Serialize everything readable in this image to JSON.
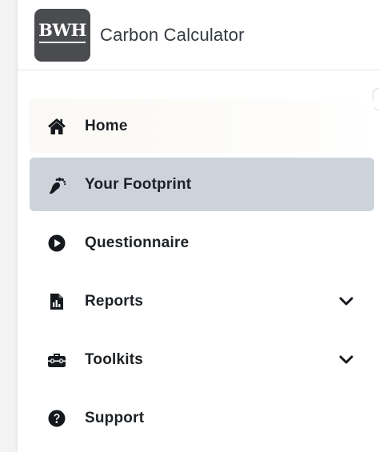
{
  "brand": {
    "logo_text": "BWH",
    "app_title": "Carbon Calculator"
  },
  "nav": {
    "items": [
      {
        "label": "Home",
        "icon": "home-icon",
        "active": false,
        "expandable": false
      },
      {
        "label": "Your Footprint",
        "icon": "footprint-icon",
        "active": true,
        "expandable": false
      },
      {
        "label": "Questionnaire",
        "icon": "play-circle-icon",
        "active": false,
        "expandable": false
      },
      {
        "label": "Reports",
        "icon": "report-file-icon",
        "active": false,
        "expandable": true
      },
      {
        "label": "Toolkits",
        "icon": "toolbox-icon",
        "active": false,
        "expandable": true
      },
      {
        "label": "Support",
        "icon": "question-circle-icon",
        "active": false,
        "expandable": false
      }
    ]
  },
  "colors": {
    "active_bg": "#cdd3db",
    "logo_bg": "#4a4c4f",
    "text": "#1d2125",
    "icon": "#15181c"
  }
}
